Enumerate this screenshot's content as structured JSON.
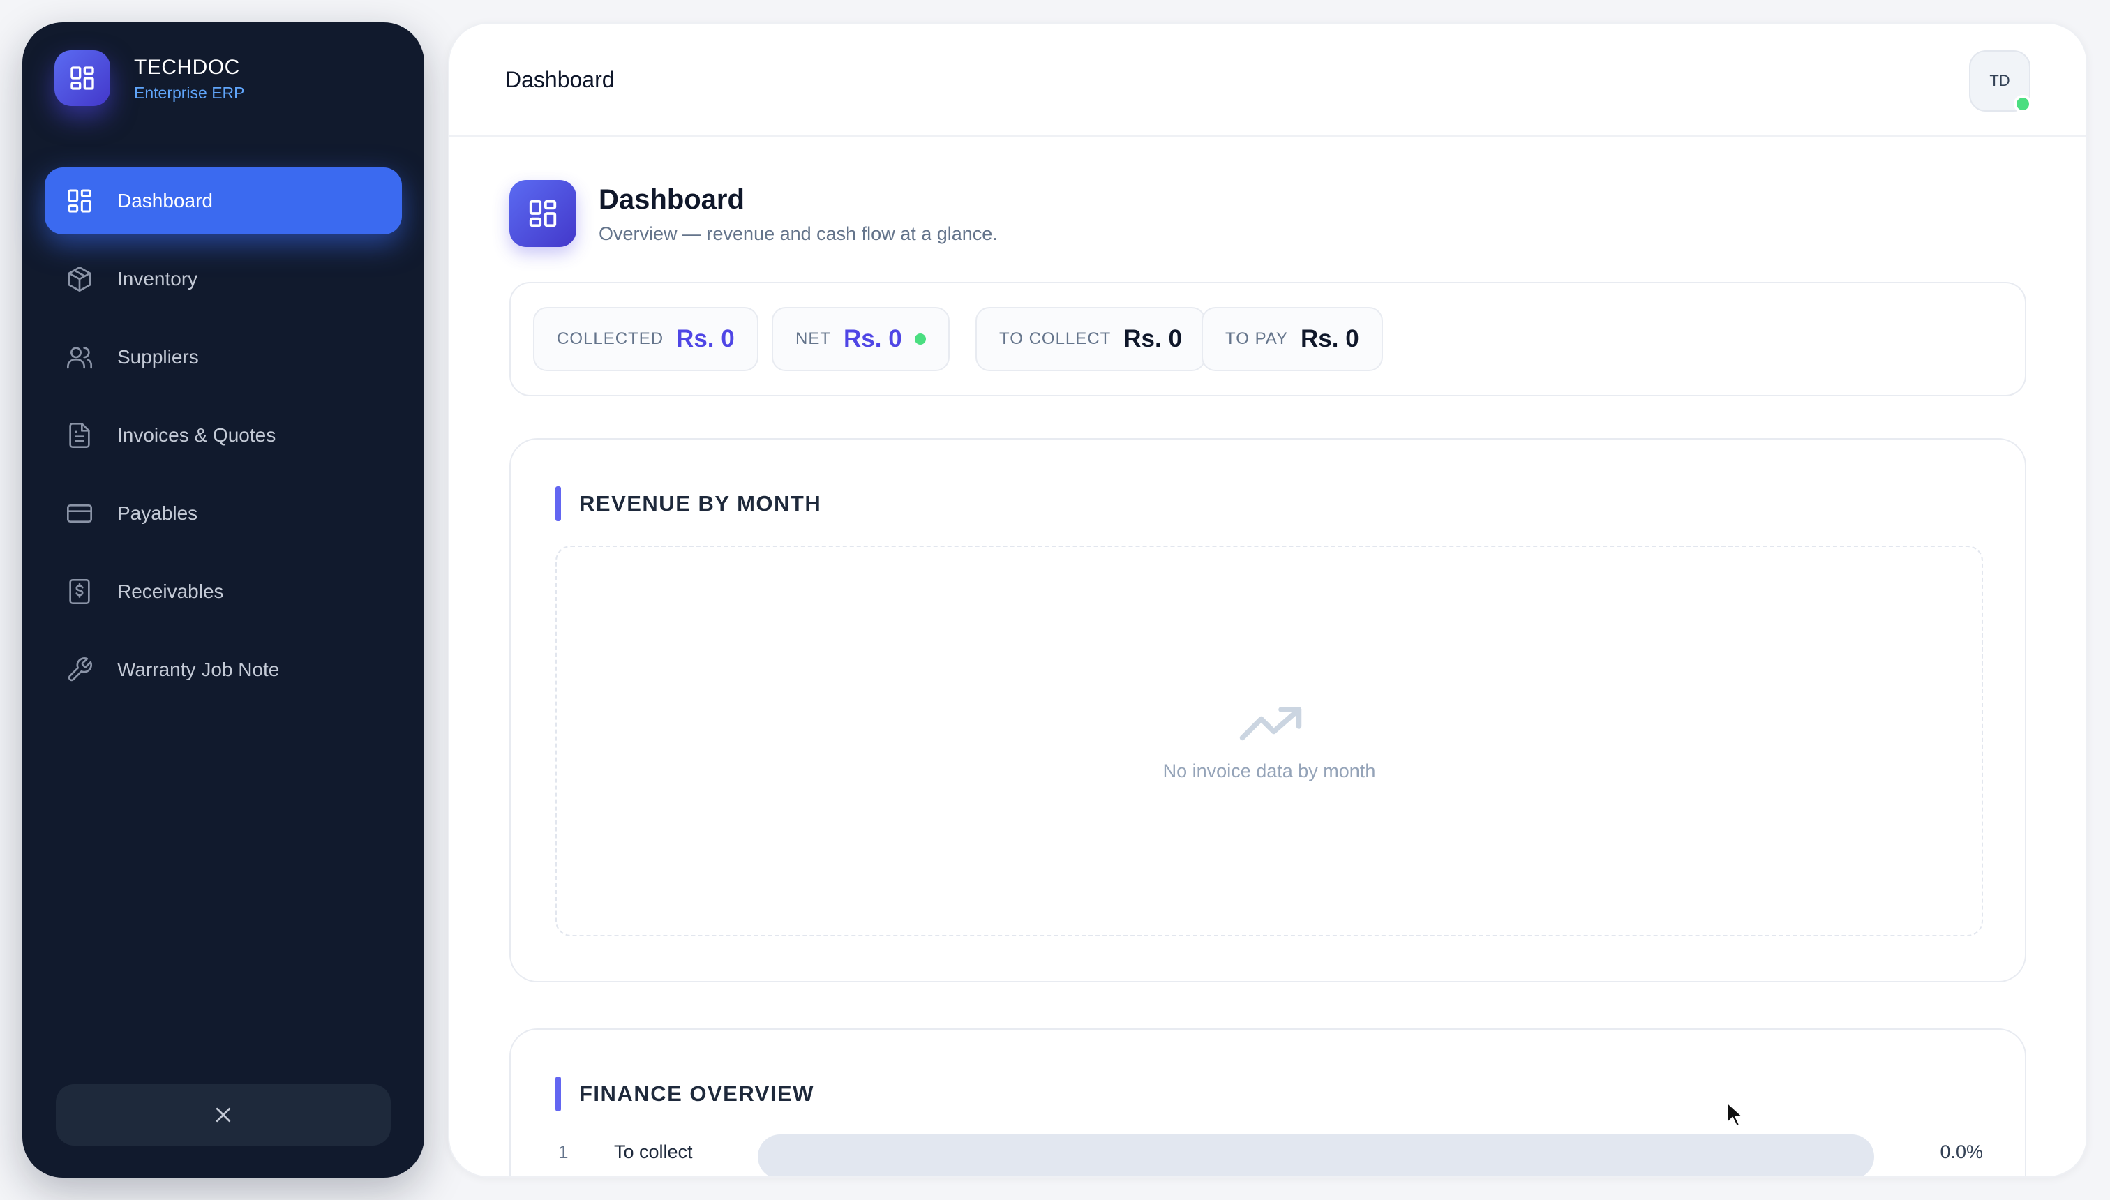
{
  "brand": {
    "name": "TECHDOC",
    "subtitle": "Enterprise ERP"
  },
  "sidebar": {
    "items": [
      {
        "label": "Dashboard",
        "icon": "dashboard-icon",
        "active": true
      },
      {
        "label": "Inventory",
        "icon": "box-icon",
        "active": false
      },
      {
        "label": "Suppliers",
        "icon": "users-icon",
        "active": false
      },
      {
        "label": "Invoices & Quotes",
        "icon": "document-icon",
        "active": false
      },
      {
        "label": "Payables",
        "icon": "credit-card-icon",
        "active": false
      },
      {
        "label": "Receivables",
        "icon": "receipt-icon",
        "active": false
      },
      {
        "label": "Warranty Job Note",
        "icon": "wrench-icon",
        "active": false
      }
    ],
    "collapse_icon": "close-icon"
  },
  "topbar": {
    "title": "Dashboard",
    "avatar_initials": "TD",
    "status_color": "#4ade80"
  },
  "page": {
    "title": "Dashboard",
    "subtitle": "Overview — revenue and cash flow at a glance."
  },
  "stats": [
    {
      "label": "COLLECTED",
      "value": "Rs. 0"
    },
    {
      "label": "NET",
      "value": "Rs. 0"
    },
    {
      "label": "TO COLLECT",
      "value": "Rs. 0"
    },
    {
      "label": "TO PAY",
      "value": "Rs. 0"
    }
  ],
  "revenue": {
    "title": "REVENUE BY MONTH",
    "empty_icon": "trending-up-icon",
    "empty_text": "No invoice data by month"
  },
  "finance": {
    "title": "FINANCE OVERVIEW",
    "rows": [
      {
        "index": "1",
        "label": "To collect",
        "percent": "0.0%",
        "fraction": 0
      }
    ]
  },
  "colors": {
    "accent": "#4f46e5",
    "active_nav": "#3b6af0",
    "sidebar_bg": "#111a2d"
  }
}
